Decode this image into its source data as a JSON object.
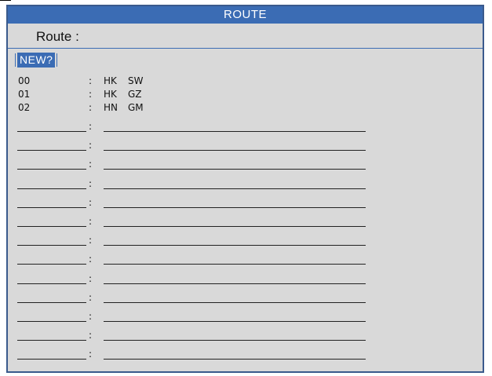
{
  "window": {
    "title": "ROUTE"
  },
  "route_field": {
    "label": "Route :"
  },
  "new_button": {
    "label": "NEW?"
  },
  "separator": ":",
  "routes": [
    {
      "code": "00",
      "origin": "HK",
      "destination": "SW"
    },
    {
      "code": "01",
      "origin": "HK",
      "destination": "GZ"
    },
    {
      "code": "02",
      "origin": "HN",
      "destination": "GM"
    }
  ],
  "empty_slots": 14,
  "colors": {
    "title_bar": "#3b6cb4",
    "panel_background": "#d9d9d9",
    "frame_border": "#3a5a8c",
    "highlight_text": "#ffffff"
  }
}
